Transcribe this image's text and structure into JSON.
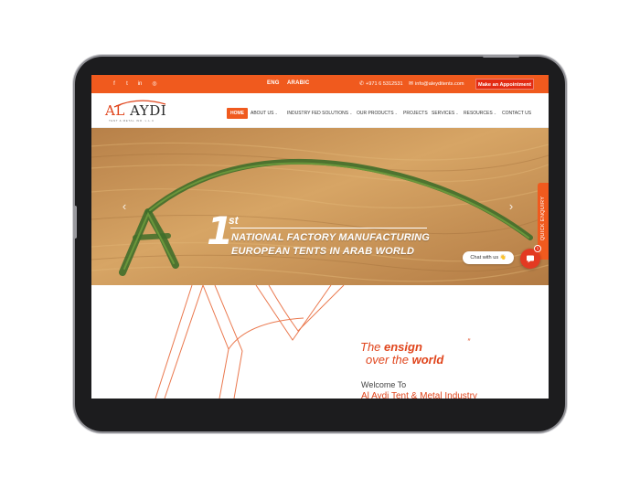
{
  "topbar": {
    "social": [
      {
        "icon": "facebook-icon",
        "glyph": "f"
      },
      {
        "icon": "twitter-icon",
        "glyph": "t"
      },
      {
        "icon": "linkedin-icon",
        "glyph": "in"
      },
      {
        "icon": "instagram-icon",
        "glyph": "◎"
      }
    ],
    "lang_eng": "ENG",
    "lang_arabic": "ARABIC",
    "phone": "+971 6 5312531",
    "email": "info@aleyditents.com",
    "appointment_label": "Make an Appointment"
  },
  "logo": {
    "text_al": "AL",
    "text_rest": "AYDI",
    "subtitle": "TENT & METAL IND. L.L.C"
  },
  "nav": {
    "items": [
      {
        "label": "HOME",
        "active": true
      },
      {
        "label": "ABOUT US",
        "chevron": "⌄"
      },
      {
        "label": "INDUSTRY FED SOLUTIONS",
        "chevron": "⌄"
      },
      {
        "label": "OUR PRODUCTS",
        "chevron": "⌄"
      },
      {
        "label": "PROJECTS"
      },
      {
        "label": "SERVICES",
        "chevron": "⌄"
      },
      {
        "label": "RESOURCES",
        "chevron": "⌄"
      },
      {
        "label": "CONTACT US"
      }
    ]
  },
  "hero": {
    "number": "1",
    "superscript": "st",
    "line1": "NATIONAL FACTORY MANUFACTURING",
    "line2": "EUROPEAN TENTS IN ARAB WORLD",
    "prev_glyph": "‹",
    "next_glyph": "›"
  },
  "side": {
    "quick_enquiry": "QUICK ENQUIRY",
    "chat_label": "Chat with us 👋",
    "chat_badge": "1"
  },
  "intro": {
    "tag1_pre": "The ",
    "tag1_bold": "ensign",
    "tag2_pre": "over the ",
    "tag2_bold": "world",
    "quote_mark": "”",
    "welcome": "Welcome To",
    "company": "Al Aydi Tent & Metal Industry"
  },
  "colors": {
    "brand_orange": "#f05a1e",
    "accent_red": "#e32b12",
    "tablet_frame": "#1c1c1e"
  }
}
